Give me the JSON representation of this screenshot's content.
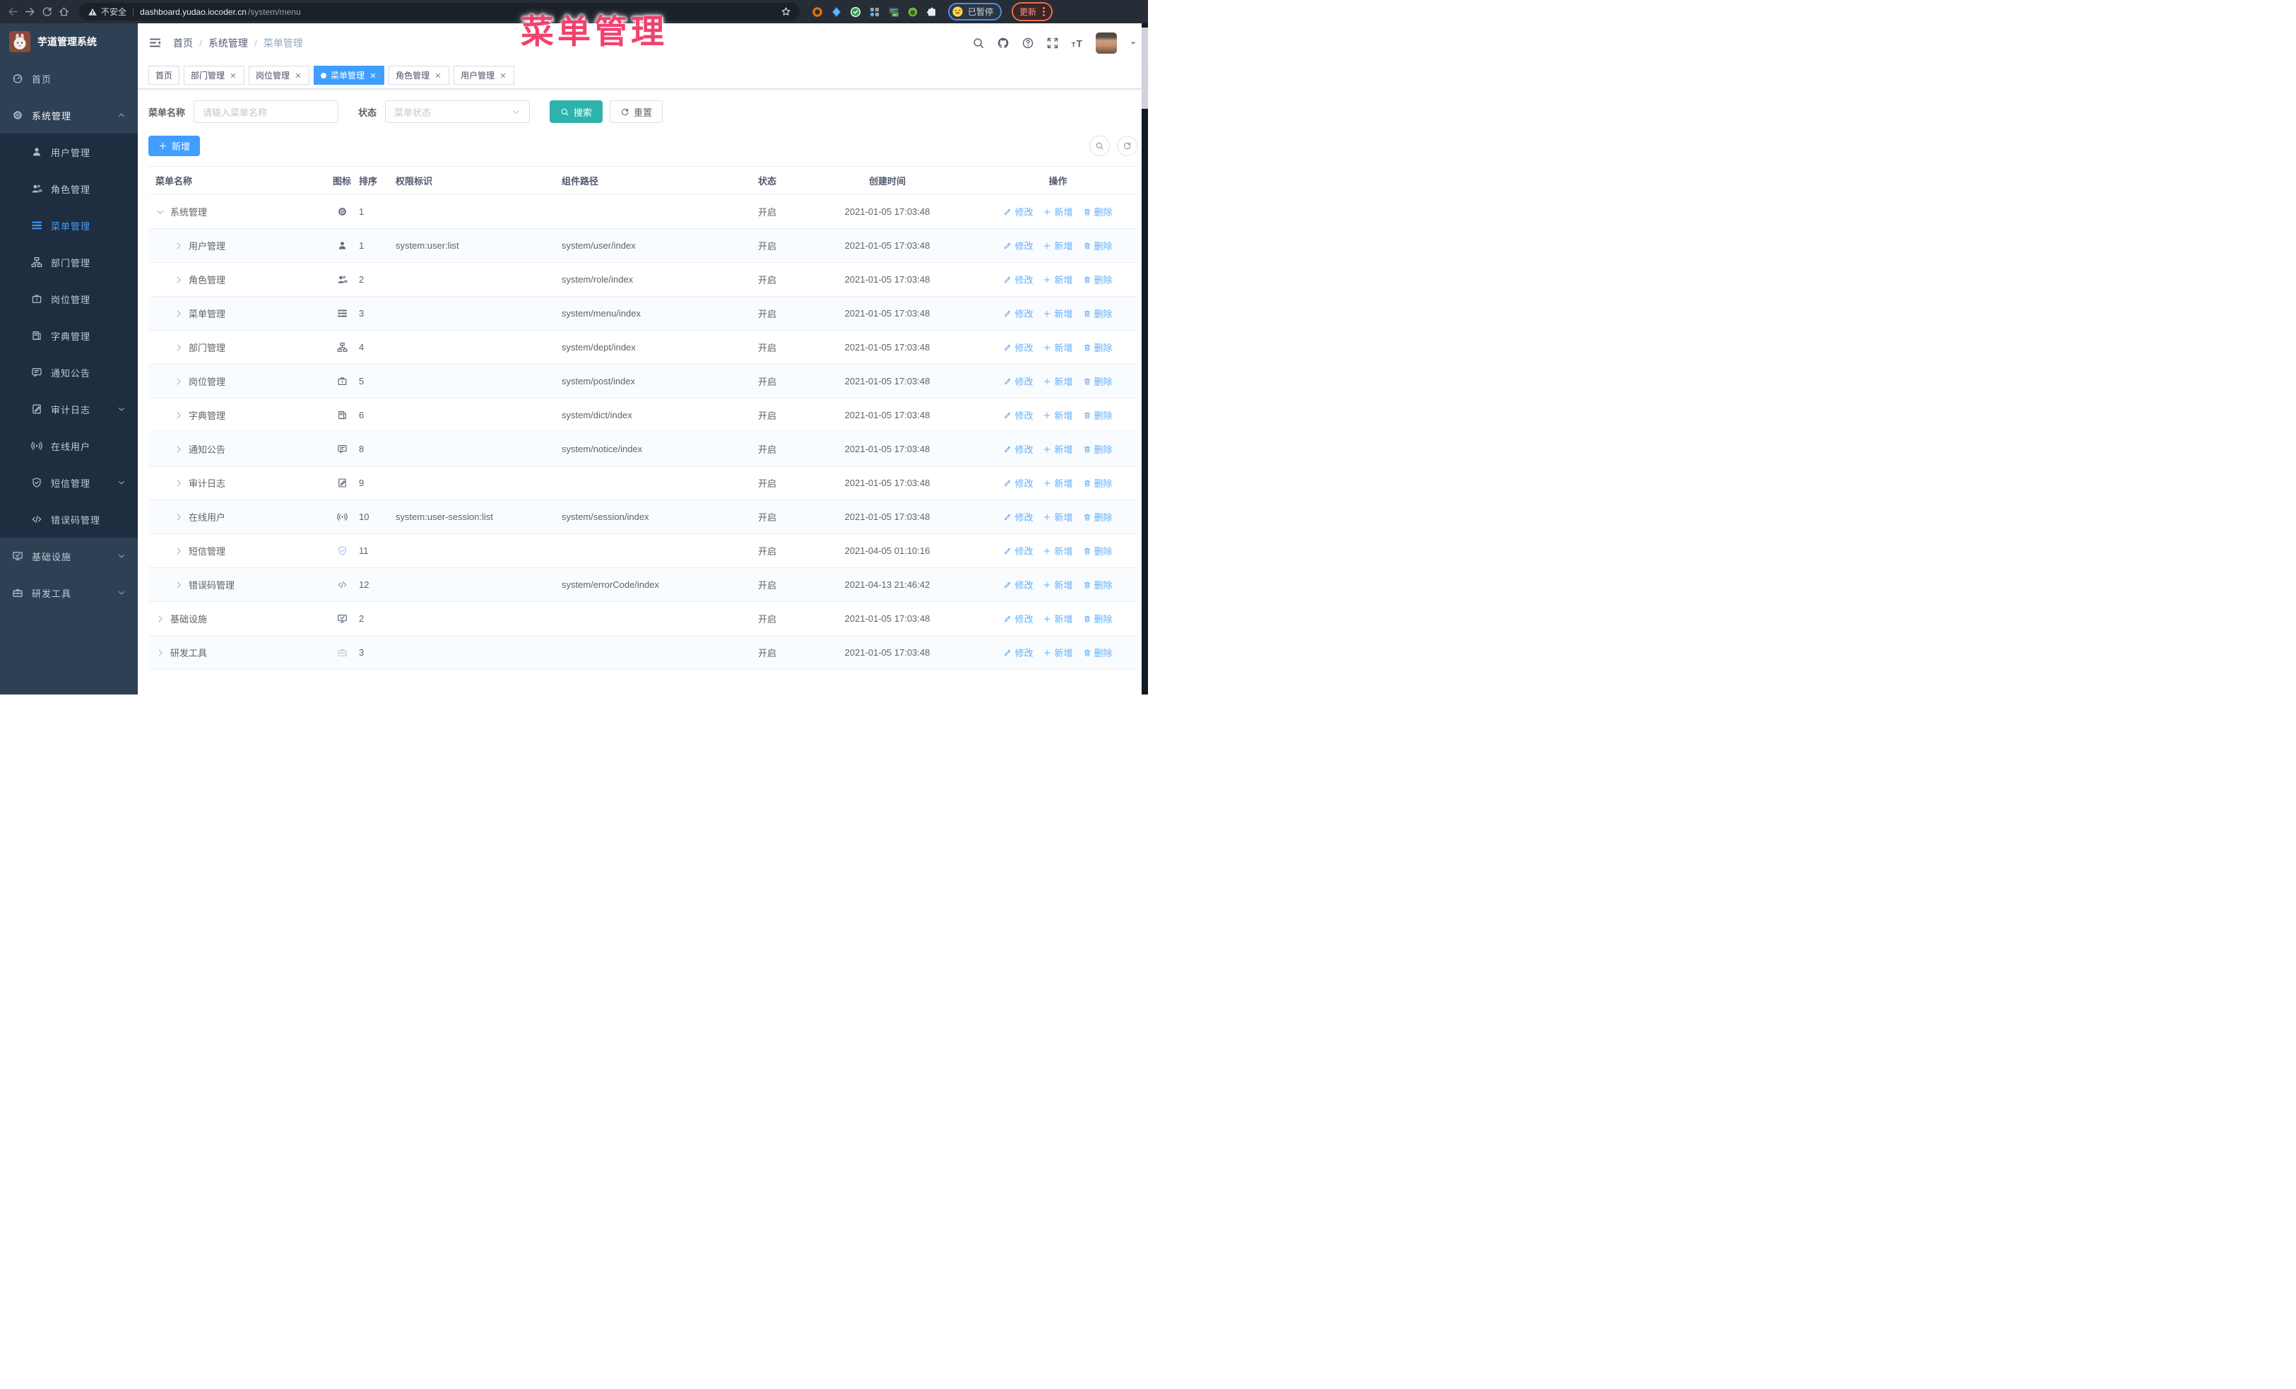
{
  "watermark": "菜单管理",
  "browser": {
    "security_label": "不安全",
    "url_host": "dashboard.yudao.iocoder.cn",
    "url_path": "/system/menu",
    "profile_label": "已暂停",
    "update_label": "更新",
    "extension_icons": [
      "target-ext-icon",
      "gem-ext-icon",
      "verified-ext-icon",
      "grid-ext-icon",
      "switch-on-ext-icon",
      "monkey-ext-icon",
      "puzzle-ext-icon"
    ]
  },
  "sidebar": {
    "logo_title": "芋道管理系统",
    "items": [
      {
        "label": "首页",
        "icon": "dashboard-icon",
        "level": 1
      },
      {
        "label": "系统管理",
        "icon": "gear-icon",
        "level": 1,
        "expanded": true,
        "chevron": "up"
      },
      {
        "label": "用户管理",
        "icon": "user-icon",
        "level": 2
      },
      {
        "label": "角色管理",
        "icon": "users-icon",
        "level": 2
      },
      {
        "label": "菜单管理",
        "icon": "tree-table-icon",
        "level": 2,
        "active": true
      },
      {
        "label": "部门管理",
        "icon": "tree-icon",
        "level": 2
      },
      {
        "label": "岗位管理",
        "icon": "briefcase-icon",
        "level": 2
      },
      {
        "label": "字典管理",
        "icon": "book-icon",
        "level": 2
      },
      {
        "label": "通知公告",
        "icon": "message-icon",
        "level": 2
      },
      {
        "label": "审计日志",
        "icon": "log-icon",
        "level": 2,
        "chevron": "down"
      },
      {
        "label": "在线用户",
        "icon": "online-icon",
        "level": 2
      },
      {
        "label": "短信管理",
        "icon": "shield-check-icon",
        "level": 2,
        "chevron": "down"
      },
      {
        "label": "错误码管理",
        "icon": "code-icon",
        "level": 2
      },
      {
        "label": "基础设施",
        "icon": "monitor-icon",
        "level": 1,
        "chevron": "down"
      },
      {
        "label": "研发工具",
        "icon": "toolbox-icon",
        "level": 1,
        "chevron": "down"
      }
    ]
  },
  "header": {
    "breadcrumb": [
      "首页",
      "系统管理",
      "菜单管理"
    ],
    "icons": [
      "search-icon",
      "github-icon",
      "help-icon",
      "fullscreen-icon",
      "font-size-icon"
    ]
  },
  "tabs": [
    {
      "label": "首页"
    },
    {
      "label": "部门管理",
      "closable": true
    },
    {
      "label": "岗位管理",
      "closable": true
    },
    {
      "label": "菜单管理",
      "closable": true,
      "active": true
    },
    {
      "label": "角色管理",
      "closable": true
    },
    {
      "label": "用户管理",
      "closable": true
    }
  ],
  "filters": {
    "name_label": "菜单名称",
    "name_placeholder": "请输入菜单名称",
    "status_label": "状态",
    "status_placeholder": "菜单状态",
    "search_label": "搜索",
    "reset_label": "重置"
  },
  "toolbar": {
    "add_label": "新增"
  },
  "table": {
    "columns": [
      "菜单名称",
      "图标",
      "排序",
      "权限标识",
      "组件路径",
      "状态",
      "创建时间",
      "操作"
    ],
    "actions": {
      "edit": "修改",
      "add": "新增",
      "delete": "删除"
    },
    "rows": [
      {
        "name": "系统管理",
        "icon": "gear-icon",
        "level": 1,
        "expanded": true,
        "sort": "1",
        "perms": "",
        "component": "",
        "status": "开启",
        "time": "2021-01-05 17:03:48"
      },
      {
        "name": "用户管理",
        "icon": "user-icon",
        "level": 2,
        "sort": "1",
        "perms": "system:user:list",
        "component": "system/user/index",
        "status": "开启",
        "time": "2021-01-05 17:03:48"
      },
      {
        "name": "角色管理",
        "icon": "users-icon",
        "level": 2,
        "sort": "2",
        "perms": "",
        "component": "system/role/index",
        "status": "开启",
        "time": "2021-01-05 17:03:48"
      },
      {
        "name": "菜单管理",
        "icon": "tree-table-icon",
        "level": 2,
        "sort": "3",
        "perms": "",
        "component": "system/menu/index",
        "status": "开启",
        "time": "2021-01-05 17:03:48"
      },
      {
        "name": "部门管理",
        "icon": "tree-icon",
        "level": 2,
        "sort": "4",
        "perms": "",
        "component": "system/dept/index",
        "status": "开启",
        "time": "2021-01-05 17:03:48"
      },
      {
        "name": "岗位管理",
        "icon": "briefcase-icon",
        "level": 2,
        "sort": "5",
        "perms": "",
        "component": "system/post/index",
        "status": "开启",
        "time": "2021-01-05 17:03:48"
      },
      {
        "name": "字典管理",
        "icon": "book-icon",
        "level": 2,
        "sort": "6",
        "perms": "",
        "component": "system/dict/index",
        "status": "开启",
        "time": "2021-01-05 17:03:48"
      },
      {
        "name": "通知公告",
        "icon": "message-icon",
        "level": 2,
        "sort": "8",
        "perms": "",
        "component": "system/notice/index",
        "status": "开启",
        "time": "2021-01-05 17:03:48"
      },
      {
        "name": "审计日志",
        "icon": "log-icon",
        "level": 2,
        "sort": "9",
        "perms": "",
        "component": "",
        "status": "开启",
        "time": "2021-01-05 17:03:48"
      },
      {
        "name": "在线用户",
        "icon": "online-icon",
        "level": 2,
        "sort": "10",
        "perms": "system:user-session:list",
        "component": "system/session/index",
        "status": "开启",
        "time": "2021-01-05 17:03:48"
      },
      {
        "name": "短信管理",
        "icon": "shield-check-icon",
        "icon_color": "#a9cdf5",
        "level": 2,
        "sort": "11",
        "perms": "",
        "component": "",
        "status": "开启",
        "time": "2021-04-05 01:10:16"
      },
      {
        "name": "错误码管理",
        "icon": "code-icon",
        "icon_color": "#8f98a6",
        "level": 2,
        "sort": "12",
        "perms": "",
        "component": "system/errorCode/index",
        "status": "开启",
        "time": "2021-04-13 21:46:42"
      },
      {
        "name": "基础设施",
        "icon": "monitor-icon",
        "level": 1,
        "sort": "2",
        "perms": "",
        "component": "",
        "status": "开启",
        "time": "2021-01-05 17:03:48"
      },
      {
        "name": "研发工具",
        "icon": "toolbox-icon",
        "icon_color": "#c8ccd4",
        "level": 1,
        "sort": "3",
        "perms": "",
        "component": "",
        "status": "开启",
        "time": "2021-01-05 17:03:48"
      }
    ]
  }
}
